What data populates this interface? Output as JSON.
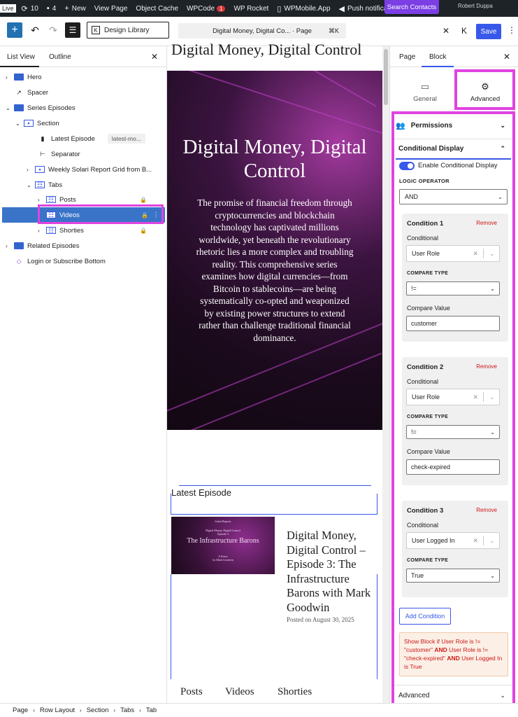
{
  "adminbar": {
    "live": "Live",
    "updates": "10",
    "comments": "4",
    "new": "New",
    "view_page": "View Page",
    "object_cache": "Object Cache",
    "wpcode": "WPCode",
    "wpcode_badge": "1",
    "wprocket": "WP Rocket",
    "wpmobile": "WPMobile.App",
    "push": "Push notification"
  },
  "topbar": {
    "design_library": "Design Library",
    "command_title": "Digital Money, Digital Co... · Page",
    "shortcut": "⌘K",
    "search_contacts": "Search Contacts",
    "user_name": "Robert Duppa",
    "save": "Save"
  },
  "listview": {
    "tab_list": "List View",
    "tab_outline": "Outline",
    "items": [
      {
        "label": "Hero"
      },
      {
        "label": "Spacer"
      },
      {
        "label": "Series Episodes"
      },
      {
        "label": "Section"
      },
      {
        "label": "Latest Episode",
        "tag": "latest-mo..."
      },
      {
        "label": "Separator"
      },
      {
        "label": "Weekly Solari Report Grid from B..."
      },
      {
        "label": "Tabs"
      },
      {
        "label": "Posts"
      },
      {
        "label": "Videos"
      },
      {
        "label": "Shorties"
      },
      {
        "label": "Related Episodes"
      },
      {
        "label": "Login or Subscribe Bottom"
      }
    ]
  },
  "canvas": {
    "top_title": "Digital Money, Digital Control",
    "hero_title": "Digital Money, Digital Control",
    "hero_desc": "The promise of financial freedom through cryptocurrencies and blockchain technology has captivated millions worldwide, yet beneath the revolutionary rhetoric lies a more complex and troubling reality. This comprehensive series examines how digital currencies—from Bitcoin to stablecoins—are being systematically co-opted and weaponized by existing power structures to extend rather than challenge traditional financial dominance.",
    "latest_heading": "Latest Episode",
    "thumb": {
      "l1": "Solari Reports",
      "l2": "Digital Money, Digital Control",
      "l3": "Episode 3",
      "l4": "The Infrastructure Barons",
      "l5": "A Series",
      "l6": "by Mark Goodwin"
    },
    "ep_title": "Digital Money, Digital Control – Episode 3: The Infrastructure Barons with Mark Goodwin",
    "ep_date": "Posted on August 30, 2025",
    "tabs": [
      "Posts",
      "Videos",
      "Shorties"
    ]
  },
  "breadcrumb": [
    "Page",
    "Row Layout",
    "Section",
    "Tabs",
    "Tab"
  ],
  "inspector": {
    "tab_page": "Page",
    "tab_block": "Block",
    "general": "General",
    "advanced": "Advanced",
    "permissions": "Permissions",
    "conditional_display": "Conditional Display",
    "enable_label": "Enable Conditional Display",
    "enabled": true,
    "logic_label": "LOGIC OPERATOR",
    "logic_value": "AND",
    "conditions": [
      {
        "title": "Condition 1",
        "remove": "Remove",
        "conditional_label": "Conditional",
        "conditional": "User Role",
        "compare_type_label": "COMPARE TYPE",
        "compare_type": "!=",
        "compare_value_label": "Compare Value",
        "compare_value": "customer"
      },
      {
        "title": "Condition 2",
        "remove": "Remove",
        "conditional_label": "Conditional",
        "conditional": "User Role",
        "compare_type_label": "COMPARE TYPE",
        "compare_type": "!=",
        "compare_value_label": "Compare Value",
        "compare_value": "check-expired"
      },
      {
        "title": "Condition 3",
        "remove": "Remove",
        "conditional_label": "Conditional",
        "conditional": "User Logged In",
        "compare_type_label": "COMPARE TYPE",
        "compare_type": "True"
      }
    ],
    "add_condition": "Add Condition",
    "summary": {
      "p1": "Show Block if User Role is != \"customer\" ",
      "and1": "AND",
      "p2": " User Role is != \"check-expired\" ",
      "and2": "AND",
      "p3": " User Logged In is True"
    },
    "advanced_section": "Advanced"
  },
  "colors": {
    "accent": "#3858e9",
    "highlight": "#e043e0",
    "danger": "#cc1818"
  }
}
